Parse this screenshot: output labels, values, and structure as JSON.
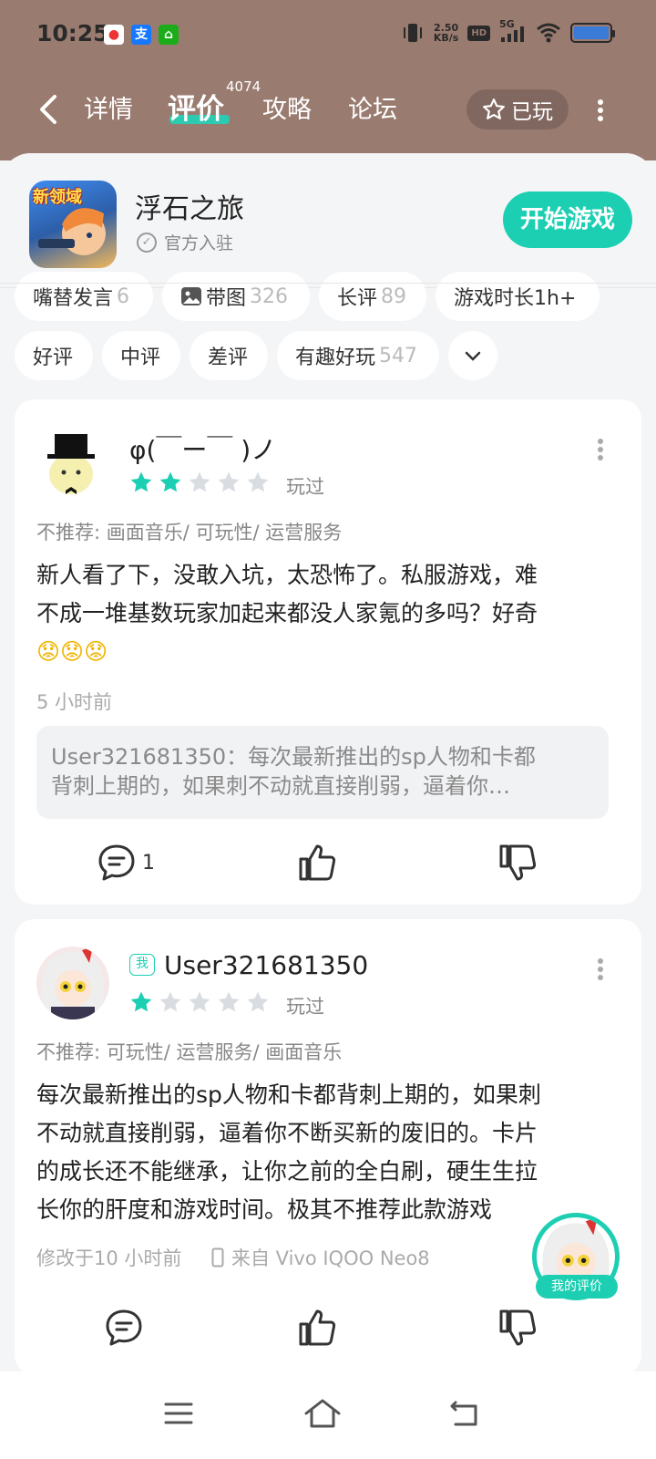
{
  "status_bar": {
    "time": "10:25",
    "net_speed_value": "2.50",
    "net_speed_unit": "KB/s",
    "hd_label": "HD",
    "signal_label": "5G"
  },
  "nav": {
    "tabs": [
      {
        "label": "详情",
        "active": false
      },
      {
        "label": "评价",
        "active": true
      },
      {
        "label": "攻略",
        "active": false
      },
      {
        "label": "论坛",
        "active": false
      }
    ],
    "review_count": "4074",
    "played_button": "已玩"
  },
  "game": {
    "name": "浮石之旅",
    "official_label": "官方入驻",
    "icon_text": "新领域",
    "start_button": "开始游戏"
  },
  "filters": {
    "row1": [
      {
        "label": "嘴替发言",
        "count": "6"
      },
      {
        "label": "带图",
        "count": "326"
      },
      {
        "label": "长评",
        "count": "89"
      },
      {
        "label": "游戏时长1h+",
        "count": ""
      }
    ],
    "row2": [
      {
        "label": "好评",
        "count": ""
      },
      {
        "label": "中评",
        "count": ""
      },
      {
        "label": "差评",
        "count": ""
      },
      {
        "label": "有趣好玩",
        "count": "547"
      }
    ]
  },
  "reviews": [
    {
      "username": "φ(￣ー￣ )ノ",
      "rating": 2,
      "played_label": "玩过",
      "tags": "不推荐: 画面音乐/ 可玩性/ 运营服务",
      "content_line1": "新人看了下，没敢入坑，太恐怖了。私服游戏，难",
      "content_line2": "不成一堆基数玩家加起来都没人家氪的多吗？好奇",
      "content_emoji": "😟😟😟",
      "time": "5 小时前",
      "reply_line1": "User321681350：每次最新推出的sp人物和卡都",
      "reply_line2": "背刺上期的，如果刺不动就直接削弱，逼着你…",
      "comment_count": "1"
    },
    {
      "me_badge": "我",
      "username": "User321681350",
      "rating": 1,
      "played_label": "玩过",
      "tags": "不推荐: 可玩性/ 运营服务/ 画面音乐",
      "content_line1": "每次最新推出的sp人物和卡都背刺上期的，如果刺",
      "content_line2": "不动就直接削弱，逼着你不断买新的废旧的。卡片",
      "content_line3": "的成长还不能继承，让你之前的全白刷，硬生生拉",
      "content_line4": "长你的肝度和游戏时间。极其不推荐此款游戏",
      "edited_time": "修改于10 小时前",
      "device": "来自 Vivo IQOO Neo8"
    }
  ],
  "floating": {
    "label": "我的评价"
  },
  "colors": {
    "accent": "#1ccfb2",
    "header_bg": "#9a7b70",
    "star_empty": "#d9dde2"
  }
}
